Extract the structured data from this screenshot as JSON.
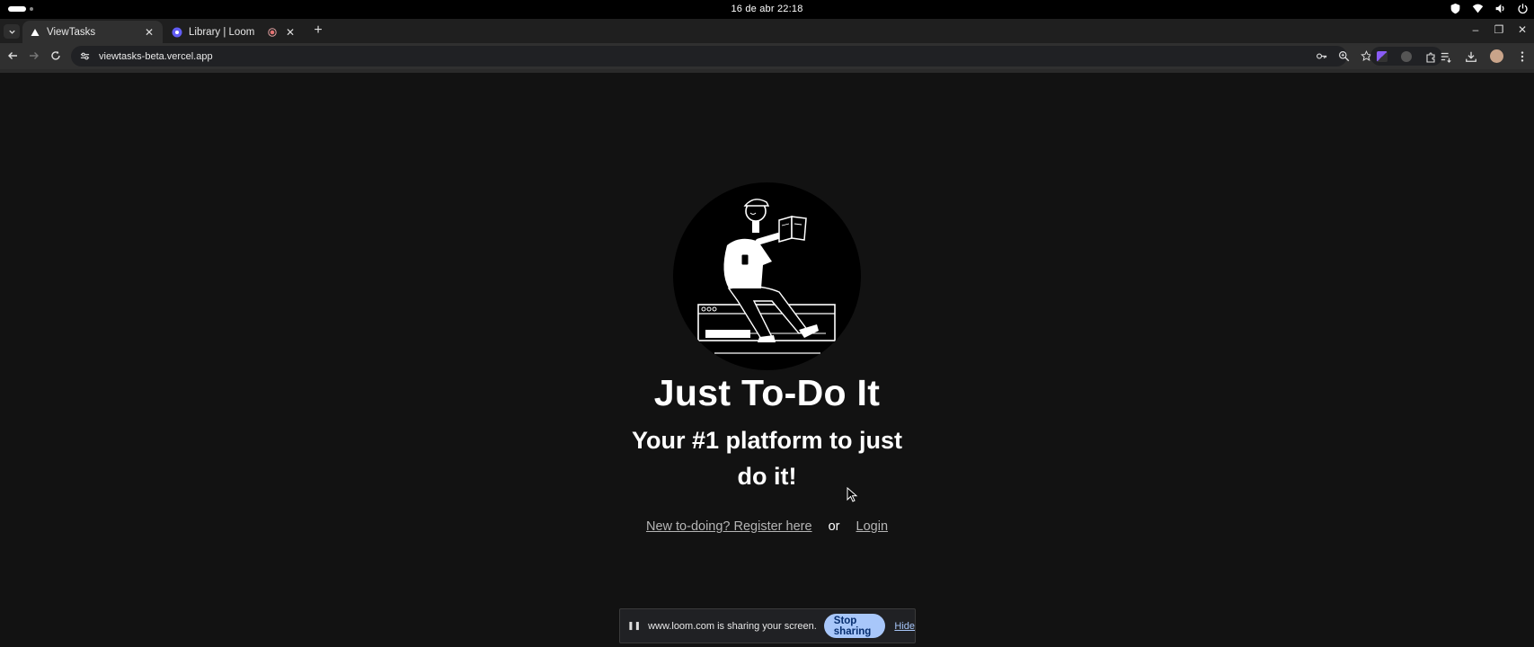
{
  "os": {
    "clock": "16 de abr  22:18",
    "tray_icons": [
      "shield-icon",
      "wifi-icon",
      "volume-icon",
      "power-icon"
    ]
  },
  "tabs": [
    {
      "title": "ViewTasks",
      "active": true,
      "favicon": "vercel-triangle-icon"
    },
    {
      "title": "Library | Loom",
      "active": false,
      "favicon": "loom-icon",
      "recording": true
    }
  ],
  "toolbar": {
    "url": "viewtasks-beta.vercel.app",
    "omnibox_actions": [
      "password-key-icon",
      "zoom-icon",
      "bookmark-star-icon"
    ],
    "right_icons": [
      "reading-list-icon",
      "download-icon",
      "profile-avatar",
      "menu-dots-icon"
    ]
  },
  "page": {
    "title": "Just To-Do It",
    "subtitle": "Your #1 platform to just do it!",
    "register_link": "New to-doing? Register here",
    "or_text": "or",
    "login_link": "Login"
  },
  "share_bar": {
    "message": "www.loom.com is sharing your screen.",
    "stop_label": "Stop sharing",
    "hide_label": "Hide"
  },
  "colors": {
    "page_bg": "#121212",
    "accent_button": "#a8c7fa"
  }
}
